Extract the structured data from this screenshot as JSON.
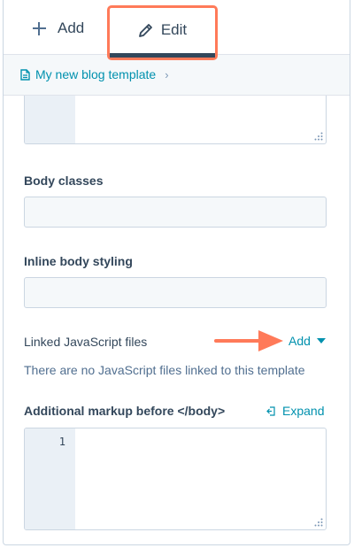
{
  "tabs": {
    "add_label": "Add",
    "edit_label": "Edit"
  },
  "breadcrumb": {
    "label": "My new blog template",
    "separator": "›"
  },
  "fields": {
    "body_classes_label": "Body classes",
    "inline_body_styling_label": "Inline body styling",
    "linked_js_label": "Linked JavaScript files",
    "linked_js_add": "Add",
    "linked_js_empty": "There are no JavaScript files linked to this template",
    "markup_before_body_label": "Additional markup before </body>",
    "expand_label": "Expand",
    "line_number": "1"
  },
  "colors": {
    "accent": "#ff7a59",
    "link": "#0091ae",
    "text": "#33475b",
    "input_bg": "#f5f8fa",
    "gutter": "#eaf0f6"
  },
  "icons": [
    "plus-icon",
    "pencil-icon",
    "document-icon",
    "chevron-right-icon",
    "caret-down-icon",
    "expand-icon",
    "resize-grip-icon",
    "arrow-annotation"
  ]
}
